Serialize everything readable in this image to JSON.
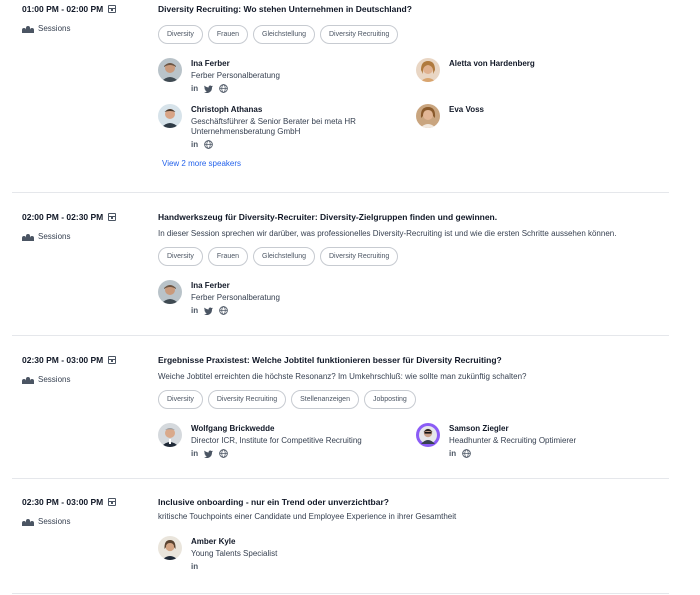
{
  "track_label": "Sessions",
  "sessions": [
    {
      "time": "01:00 PM - 02:00 PM",
      "title": "Diversity Recruiting: Wo stehen Unternehmen in Deutschland?",
      "description": "",
      "tags": [
        "Diversity",
        "Frauen",
        "Gleichstellung",
        "Diversity Recruiting"
      ],
      "speakers": [
        {
          "name": "Ina Ferber",
          "role": "Ferber Personalberatung",
          "social": [
            "linkedin",
            "twitter",
            "web"
          ]
        },
        {
          "name": "Aletta von Hardenberg",
          "role": "",
          "social": []
        },
        {
          "name": "Christoph Athanas",
          "role": "Geschäftsführer & Senior Berater bei meta HR Unternehmensberatung GmbH",
          "social": [
            "linkedin",
            "web"
          ]
        },
        {
          "name": "Eva Voss",
          "role": "",
          "social": []
        }
      ],
      "more_link": "View 2 more speakers"
    },
    {
      "time": "02:00 PM - 02:30 PM",
      "title": "Handwerkszeug für Diversity-Recruiter: Diversity-Zielgruppen finden und gewinnen.",
      "description": "In dieser Session sprechen wir darüber, was professionelles Diversity-Recruiting ist und wie die ersten Schritte aussehen können.",
      "tags": [
        "Diversity",
        "Frauen",
        "Gleichstellung",
        "Diversity Recruiting"
      ],
      "speakers": [
        {
          "name": "Ina Ferber",
          "role": "Ferber Personalberatung",
          "social": [
            "linkedin",
            "twitter",
            "web"
          ]
        }
      ]
    },
    {
      "time": "02:30 PM - 03:00 PM",
      "title": "Ergebnisse Praxistest: Welche Jobtitel funktionieren besser für Diversity Recruiting?",
      "description": "Weiche Jobtitel erreichten die höchste Resonanz? Im Umkehrschluß: wie sollte man zukünftig schalten?",
      "tags": [
        "Diversity",
        "Diversity Recruiting",
        "Stellenanzeigen",
        "Jobposting"
      ],
      "speakers": [
        {
          "name": "Wolfgang Brickwedde",
          "role": "Director ICR, Institute for Competitive Recruiting",
          "social": [
            "linkedin",
            "twitter",
            "web"
          ]
        },
        {
          "name": "Samson Ziegler",
          "role": "Headhunter & Recruiting Optimierer",
          "social": [
            "linkedin",
            "web"
          ]
        }
      ]
    },
    {
      "time": "02:30 PM - 03:00 PM",
      "title": "Inclusive onboarding - nur ein Trend oder unverzichtbar?",
      "description": "kritische Touchpoints einer Candidate und Employee Experience in ihrer Gesamtheit",
      "tags": [],
      "speakers": [
        {
          "name": "Amber Kyle",
          "role": "Young Talents Specialist",
          "social": [
            "linkedin"
          ]
        }
      ]
    }
  ]
}
